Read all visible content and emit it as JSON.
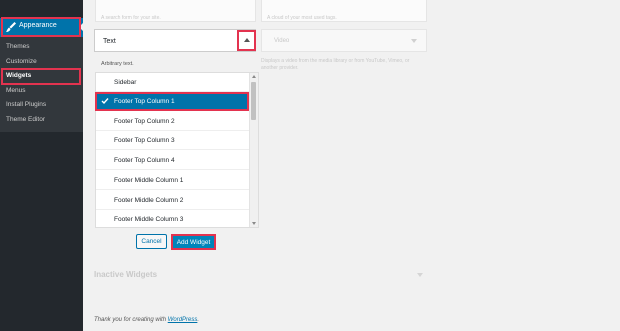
{
  "sidebar": {
    "appearance_label": "Appearance",
    "items": [
      {
        "label": "Themes"
      },
      {
        "label": "Customize"
      },
      {
        "label": "Widgets"
      },
      {
        "label": "Menus"
      },
      {
        "label": "Install Plugins"
      },
      {
        "label": "Theme Editor"
      }
    ],
    "current": "Widgets"
  },
  "background": {
    "search_desc": "A search form for your site.",
    "tag_desc": "A cloud of your most used tags.",
    "video_title": "Video",
    "video_desc": "Displays a video from the media library or from YouTube, Vimeo, or another provider."
  },
  "text_widget": {
    "title": "Text",
    "description": "Arbitrary text."
  },
  "sidebar_choices": [
    {
      "label": "Sidebar",
      "selected": false
    },
    {
      "label": "Footer Top Column 1",
      "selected": true
    },
    {
      "label": "Footer Top Column 2",
      "selected": false
    },
    {
      "label": "Footer Top Column 3",
      "selected": false
    },
    {
      "label": "Footer Top Column 4",
      "selected": false
    },
    {
      "label": "Footer Middle Column 1",
      "selected": false
    },
    {
      "label": "Footer Middle Column 2",
      "selected": false
    },
    {
      "label": "Footer Middle Column 3",
      "selected": false
    }
  ],
  "buttons": {
    "cancel": "Cancel",
    "add_widget": "Add Widget"
  },
  "inactive_widgets": "Inactive Widgets",
  "footer": {
    "prefix": "Thank you for creating with ",
    "link": "WordPress",
    "suffix": "."
  },
  "colors": {
    "accent": "#0073aa",
    "highlight": "#e3334f",
    "sidebar_bg": "#23282d"
  }
}
